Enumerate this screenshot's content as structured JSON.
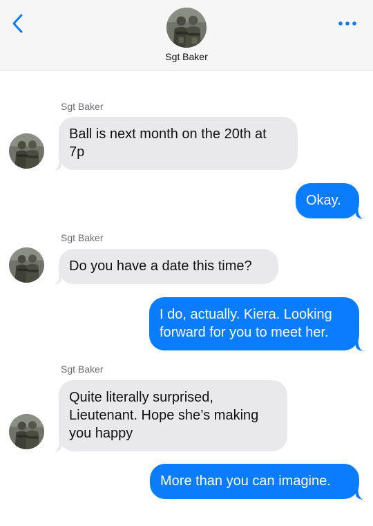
{
  "header": {
    "contact_name": "Sgt Baker",
    "back_icon": "chevron-left-icon",
    "more_icon": "ellipsis-icon",
    "accent_color": "#0a7cff"
  },
  "messages": [
    {
      "direction": "incoming",
      "sender": "Sgt Baker",
      "lines": [
        "Ball is next month on the 20th at",
        "7p"
      ]
    },
    {
      "direction": "outgoing",
      "lines": [
        "Okay."
      ]
    },
    {
      "direction": "incoming",
      "sender": "Sgt Baker",
      "lines": [
        "Do you have a date this time?"
      ]
    },
    {
      "direction": "outgoing",
      "lines": [
        "I do, actually. Kiera. Looking",
        "forward for you to meet her."
      ]
    },
    {
      "direction": "incoming",
      "sender": "Sgt Baker",
      "lines": [
        "Quite literally surprised,",
        "Lieutenant. Hope she’s making",
        "you happy"
      ]
    },
    {
      "direction": "outgoing",
      "lines": [
        "More than you can imagine."
      ]
    }
  ],
  "colors": {
    "incoming_bubble": "#e9e9eb",
    "outgoing_bubble": "#0a7cff"
  }
}
